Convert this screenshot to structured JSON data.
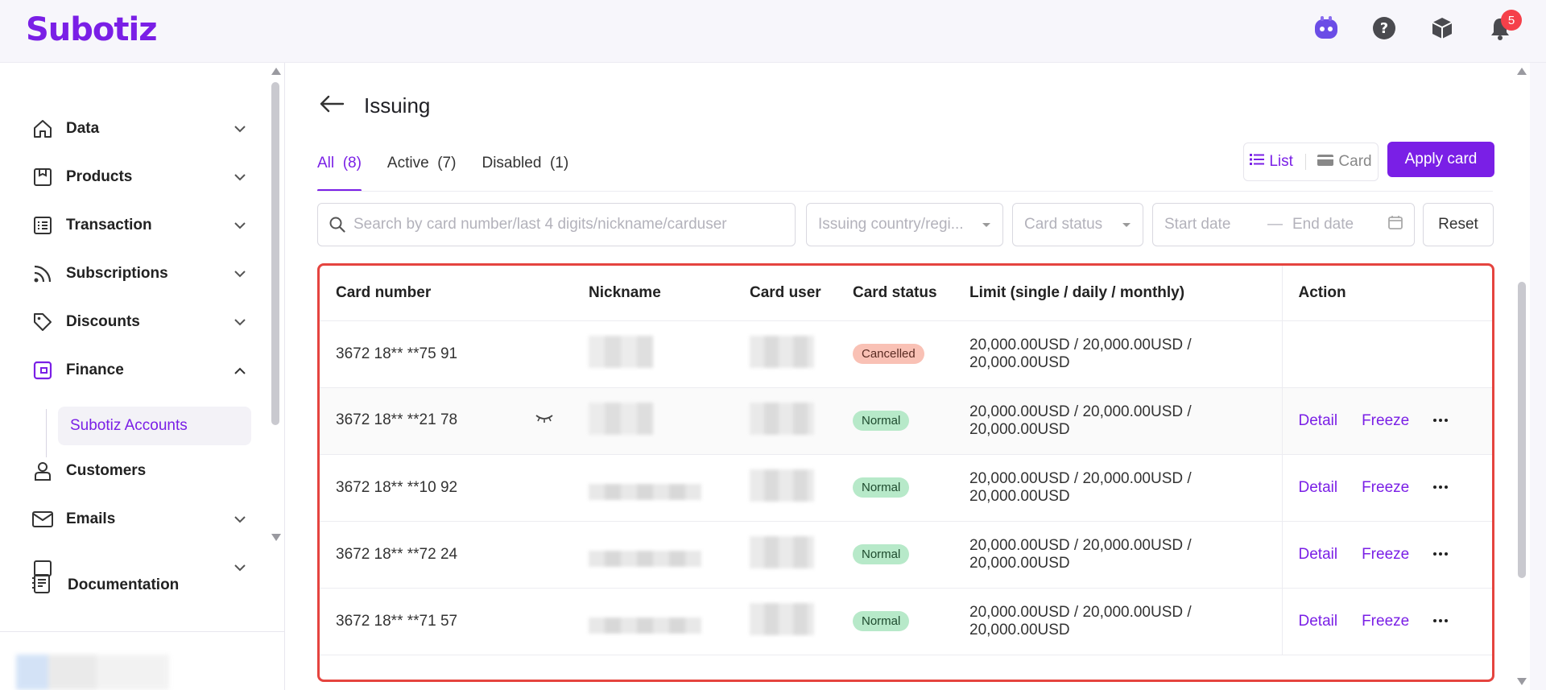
{
  "app": {
    "logo": "Subotiz",
    "notification_count": "5"
  },
  "sidebar": {
    "items": [
      {
        "label": "Data",
        "icon": "home-icon"
      },
      {
        "label": "Products",
        "icon": "box-icon"
      },
      {
        "label": "Transaction",
        "icon": "list-icon"
      },
      {
        "label": "Subscriptions",
        "icon": "rss-icon"
      },
      {
        "label": "Discounts",
        "icon": "tag-icon"
      },
      {
        "label": "Finance",
        "icon": "wallet-icon"
      },
      {
        "label": "Customers",
        "icon": "user-icon"
      },
      {
        "label": "Emails",
        "icon": "mail-icon"
      }
    ],
    "sub_item": "Subotiz Accounts",
    "documentation": "Documentation"
  },
  "page": {
    "title": "Issuing",
    "tabs": [
      {
        "label": "All",
        "count": "(8)"
      },
      {
        "label": "Active",
        "count": "(7)"
      },
      {
        "label": "Disabled",
        "count": "(1)"
      }
    ],
    "view_list": "List",
    "view_card": "Card",
    "apply_label": "Apply card",
    "filters": {
      "search_placeholder": "Search by card number/last 4 digits/nickname/carduser",
      "country_placeholder": "Issuing country/regi...",
      "status_placeholder": "Card status",
      "start_date": "Start date",
      "date_sep": "—",
      "end_date": "End date",
      "reset_label": "Reset"
    }
  },
  "table": {
    "headers": [
      "Card number",
      "Nickname",
      "Card user",
      "Card status",
      "Limit (single / daily / monthly)",
      "Action"
    ],
    "actions": {
      "detail": "Detail",
      "freeze": "Freeze"
    },
    "rows": [
      {
        "card": "3672 18** **75 91",
        "status": "Cancelled",
        "limit": "20,000.00USD / 20,000.00USD / 20,000.00USD"
      },
      {
        "card": "3672 18** **21 78",
        "status": "Normal",
        "limit": "20,000.00USD / 20,000.00USD / 20,000.00USD"
      },
      {
        "card": "3672 18** **10 92",
        "status": "Normal",
        "limit": "20,000.00USD / 20,000.00USD / 20,000.00USD"
      },
      {
        "card": "3672 18** **72 24",
        "status": "Normal",
        "limit": "20,000.00USD / 20,000.00USD / 20,000.00USD"
      },
      {
        "card": "3672 18** **71 57",
        "status": "Normal",
        "limit": "20,000.00USD / 20,000.00USD / 20,000.00USD"
      }
    ]
  },
  "colors": {
    "brand": "#7a1fe6",
    "highlight_border": "#e5443f",
    "badge_cancelled": "#f9c1b5",
    "badge_normal": "#b7e9c9"
  }
}
